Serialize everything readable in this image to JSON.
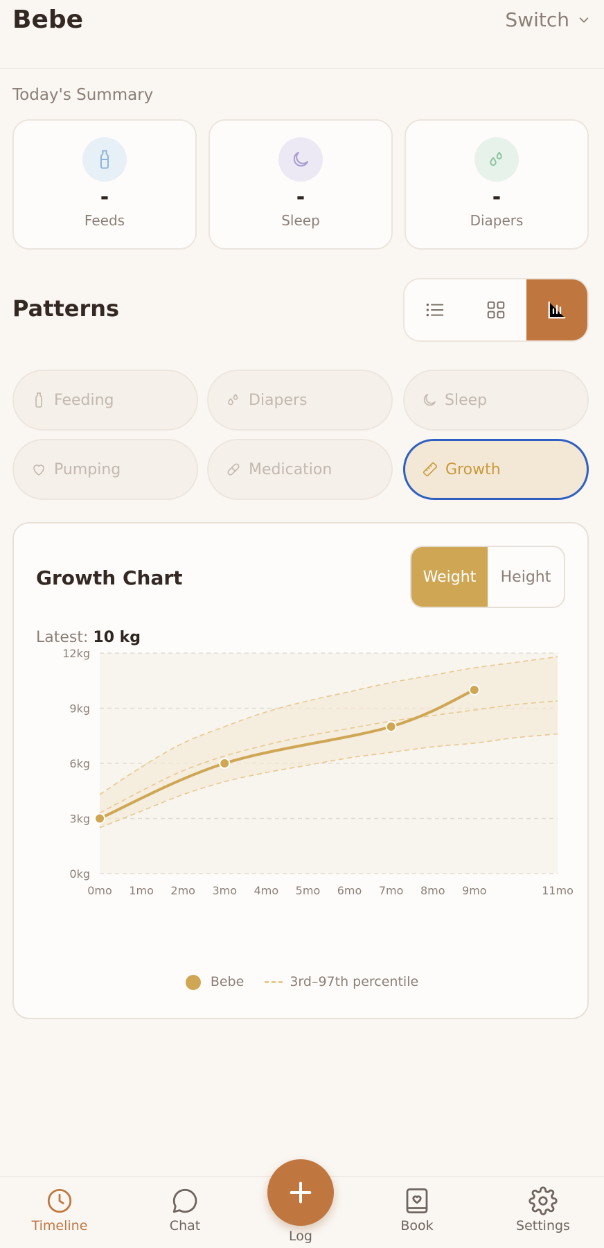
{
  "header": {
    "title": "Bebe",
    "switch_label": "Switch"
  },
  "summary": {
    "label": "Today's Summary",
    "cards": [
      {
        "value": "-",
        "label": "Feeds",
        "icon": "bottle-icon",
        "color": "#e8f0f7"
      },
      {
        "value": "-",
        "label": "Sleep",
        "icon": "moon-icon",
        "color": "#ece9f4"
      },
      {
        "value": "-",
        "label": "Diapers",
        "icon": "droplets-icon",
        "color": "#e6f2ea"
      }
    ]
  },
  "patterns": {
    "title": "Patterns",
    "view_modes": [
      "list",
      "grid",
      "chart"
    ],
    "active_view": "chart",
    "chips": [
      {
        "label": "Feeding",
        "icon": "bottle-icon"
      },
      {
        "label": "Diapers",
        "icon": "droplets-icon"
      },
      {
        "label": "Sleep",
        "icon": "moon-icon"
      },
      {
        "label": "Pumping",
        "icon": "heart-icon"
      },
      {
        "label": "Medication",
        "icon": "pill-icon"
      },
      {
        "label": "Growth",
        "icon": "ruler-icon",
        "selected": true
      }
    ]
  },
  "growth": {
    "title": "Growth Chart",
    "tabs": {
      "weight": "Weight",
      "height": "Height"
    },
    "active_tab": "Weight",
    "latest_label": "Latest:",
    "latest_value": "10 kg",
    "legend": {
      "series": "Bebe",
      "band": "3rd–97th percentile"
    }
  },
  "chart_data": {
    "type": "line",
    "x_ticks": [
      "0mo",
      "1mo",
      "2mo",
      "3mo",
      "4mo",
      "5mo",
      "6mo",
      "7mo",
      "8mo",
      "9mo",
      "11mo"
    ],
    "y_ticks": [
      "0kg",
      "3kg",
      "6kg",
      "9kg",
      "12kg"
    ],
    "xlim": [
      0,
      11
    ],
    "ylim": [
      0,
      12
    ],
    "series": [
      {
        "name": "Bebe",
        "x": [
          0,
          3,
          7,
          9
        ],
        "y": [
          3,
          6,
          8,
          10
        ],
        "color": "#cfa654"
      }
    ],
    "percentiles": {
      "x": [
        0,
        1,
        2,
        3,
        4,
        5,
        6,
        7,
        8,
        9,
        10,
        11
      ],
      "p3": [
        2.5,
        3.4,
        4.3,
        5.0,
        5.5,
        5.9,
        6.3,
        6.6,
        6.9,
        7.1,
        7.4,
        7.6
      ],
      "p50": [
        3.3,
        4.5,
        5.6,
        6.4,
        7.0,
        7.5,
        7.9,
        8.3,
        8.6,
        8.9,
        9.2,
        9.4
      ],
      "p97": [
        4.3,
        5.8,
        7.1,
        8.0,
        8.8,
        9.4,
        9.9,
        10.4,
        10.8,
        11.2,
        11.5,
        11.8
      ],
      "color": "#e7c98f"
    },
    "grid": true,
    "legend_position": "bottom"
  },
  "nav": {
    "items": [
      {
        "label": "Timeline",
        "icon": "clock-icon",
        "active": true
      },
      {
        "label": "Chat",
        "icon": "chat-icon"
      },
      {
        "label": "Book",
        "icon": "book-icon"
      },
      {
        "label": "Settings",
        "icon": "gear-icon"
      }
    ],
    "fab_label": "Log"
  },
  "colors": {
    "accent": "#c0773f",
    "gold": "#cfa654",
    "selected_border": "#2f5fc0"
  }
}
